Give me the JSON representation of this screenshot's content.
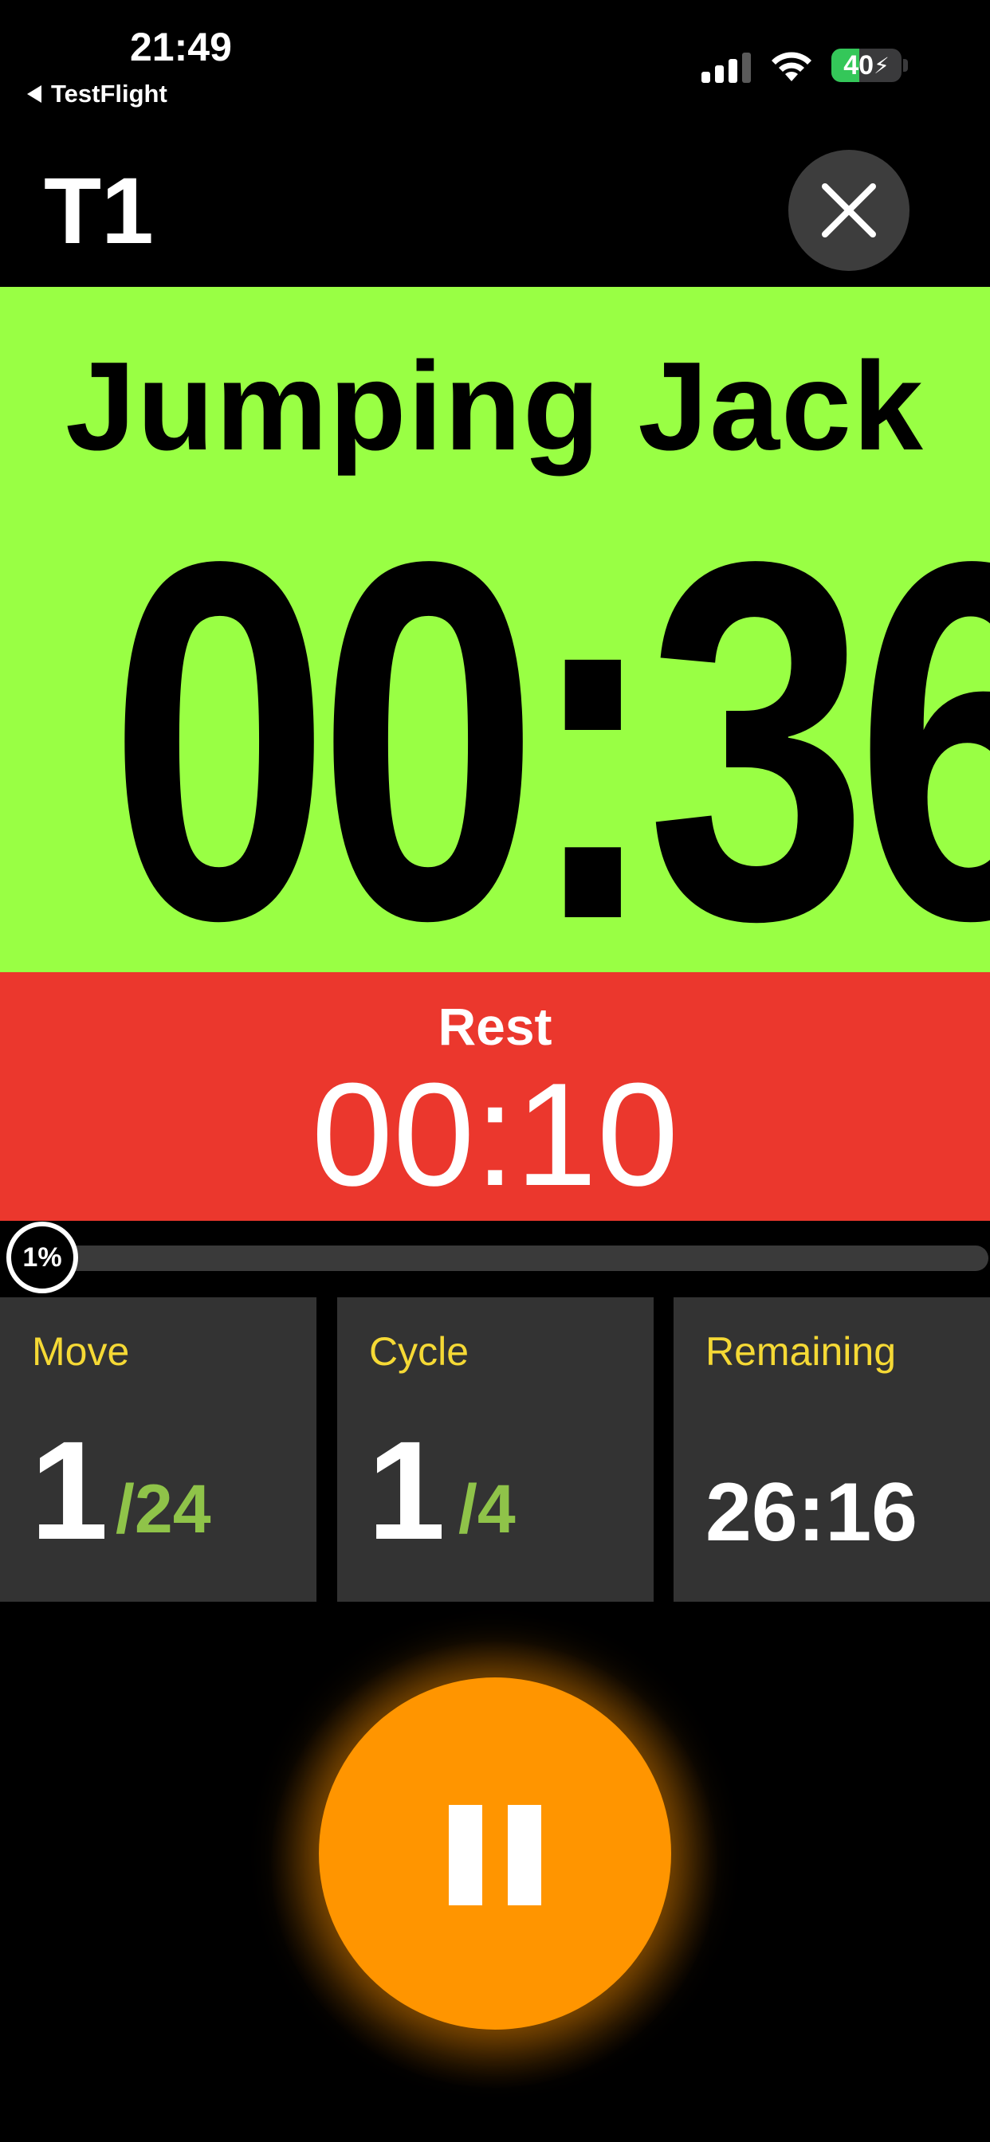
{
  "status_bar": {
    "time": "21:49",
    "back_app": "TestFlight",
    "battery_level": "40",
    "battery_percent": 40,
    "signal_bars": 3
  },
  "header": {
    "title": "T1",
    "close_icon": "close-icon"
  },
  "exercise": {
    "name": "Jumping Jack",
    "timer": "00:36",
    "color": "#99ff44"
  },
  "rest": {
    "label": "Rest",
    "timer": "00:10",
    "color": "#eb372d"
  },
  "progress": {
    "percent_label": "1%",
    "percent": 1
  },
  "stats": {
    "move": {
      "label": "Move",
      "current": "1",
      "total": "/24"
    },
    "cycle": {
      "label": "Cycle",
      "current": "1",
      "total": "/4"
    },
    "remaining": {
      "label": "Remaining",
      "value": "26:16"
    }
  },
  "controls": {
    "pause_icon": "pause-icon",
    "accent": "#ff9500"
  }
}
